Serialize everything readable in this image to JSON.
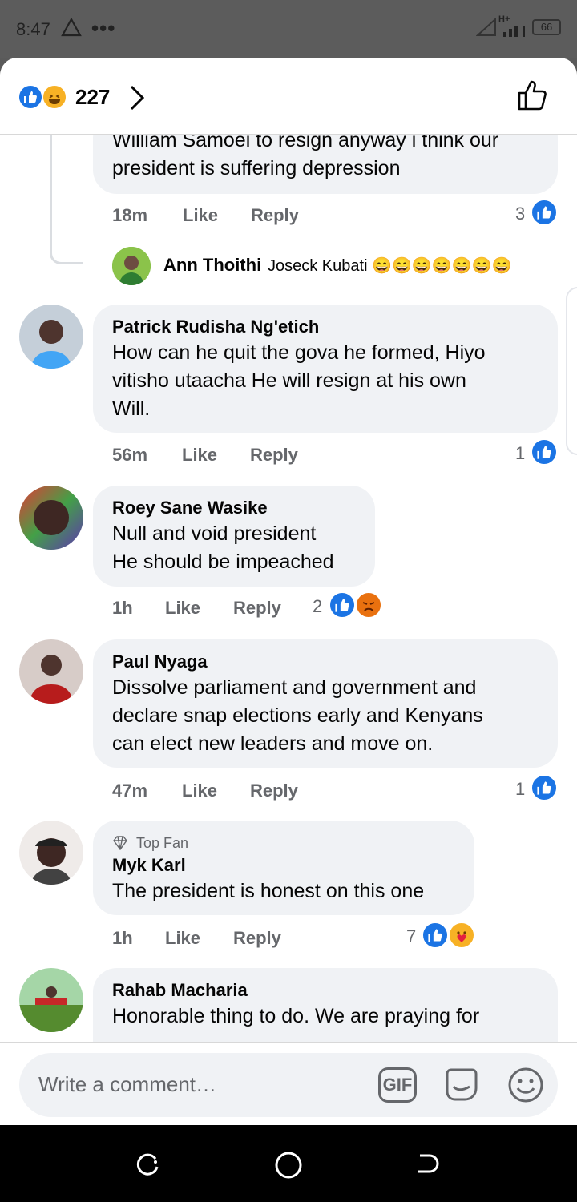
{
  "status_bar": {
    "time": "8:47",
    "network": "H+",
    "battery": "66"
  },
  "header": {
    "reaction_count": "227"
  },
  "comments": [
    {
      "text_partial": "William Samoei to resign anyway i think our\npresident is suffering depression",
      "time": "18m",
      "like": "Like",
      "reply": "Reply",
      "reactions_count": "3"
    },
    {
      "reply_author": "Ann Thoithi",
      "reply_text": "Joseck Kubati 😄😄😄😄😄😄😄"
    },
    {
      "author": "Patrick Rudisha Ng'etich",
      "text": "How can he quit the gova he formed, Hiyo\nvitisho utaacha He will resign at his own\nWill.",
      "time": "56m",
      "like": "Like",
      "reply": "Reply",
      "reactions_count": "1"
    },
    {
      "author": "Roey Sane Wasike",
      "text": "Null and void president\nHe should be impeached",
      "time": "1h",
      "like": "Like",
      "reply": "Reply",
      "reactions_count": "2"
    },
    {
      "author": "Paul Nyaga",
      "text": "Dissolve parliament and government and\ndeclare snap elections early and Kenyans\ncan elect new leaders and move on.",
      "time": "47m",
      "like": "Like",
      "reply": "Reply",
      "reactions_count": "1"
    },
    {
      "badge": "Top Fan",
      "author": "Myk Karl",
      "text": "The president is honest on this one",
      "time": "1h",
      "like": "Like",
      "reply": "Reply",
      "reactions_count": "7"
    },
    {
      "author": "Rahab Macharia",
      "text": "Honorable thing to do. We are praying for"
    }
  ],
  "composer": {
    "placeholder": "Write a comment…",
    "gif_label": "GIF"
  },
  "icons": {
    "reaction_like": "like-icon",
    "reaction_haha": "haha-icon",
    "reaction_angry": "angry-icon",
    "reaction_care": "care-icon",
    "header_like_button": "thumbs-up-outline-icon",
    "composer_sticker": "sticker-icon",
    "composer_emoji": "emoji-icon"
  },
  "colors": {
    "accent": "#1b74e4",
    "bubble": "#f0f2f5",
    "meta_text": "#65676b"
  }
}
